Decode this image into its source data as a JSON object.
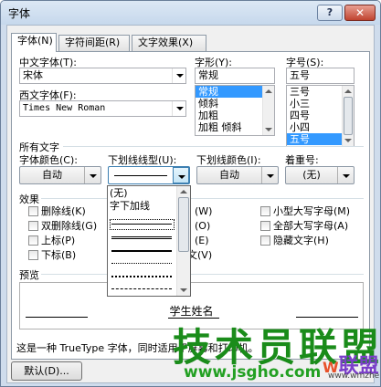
{
  "window": {
    "title": "字体",
    "help_button": "?",
    "close_button": "✕"
  },
  "tabs": [
    {
      "label": "字体(N)",
      "active": true
    },
    {
      "label": "字符间距(R)",
      "active": false
    },
    {
      "label": "文字效果(X)",
      "active": false
    }
  ],
  "font": {
    "chinese_label": "中文字体(T):",
    "chinese_value": "宋体",
    "western_label": "西文字体(F):",
    "western_value": "Times New Roman",
    "style_label": "字形(Y):",
    "style_value": "常规",
    "style_options": [
      "常规",
      "倾斜",
      "加粗",
      "加粗 倾斜"
    ],
    "style_selected_index": 0,
    "size_label": "字号(S):",
    "size_value": "五号",
    "size_options": [
      "三号",
      "小三",
      "四号",
      "小四",
      "五号"
    ],
    "size_selected_index": 4
  },
  "all_text": {
    "heading": "所有文字",
    "color_label": "字体颜色(C):",
    "color_value": "自动",
    "underline_style_label": "下划线线型(U):",
    "underline_color_label": "下划线颜色(I):",
    "underline_color_value": "自动",
    "emphasis_label": "着重号:",
    "emphasis_value": "(无)"
  },
  "underline_dropdown": {
    "items": [
      "(无)",
      "字下加线"
    ],
    "selected_index": 2
  },
  "effects": {
    "heading": "效果",
    "left": [
      "删除线(K)",
      "双删除线(G)",
      "上标(P)",
      "下标(B)"
    ],
    "middle_partial": [
      "(W)",
      "(O)",
      "(E)",
      "文(V)"
    ],
    "right": [
      "小型大写字母(M)",
      "全部大写字母(A)",
      "隐藏文字(H)"
    ]
  },
  "preview": {
    "heading": "预览",
    "sample_text": "学生姓名"
  },
  "status_text": "这是一种 TrueType 字体，同时适用于屏幕和打印机。",
  "buttons": {
    "default": "默认(D)..."
  },
  "watermark": {
    "main": "技术员联盟",
    "url": "www.jsgho.com",
    "logo": "联盟",
    "logo_prefix": "W",
    "logo_sub": "www.wmzhe.com"
  }
}
